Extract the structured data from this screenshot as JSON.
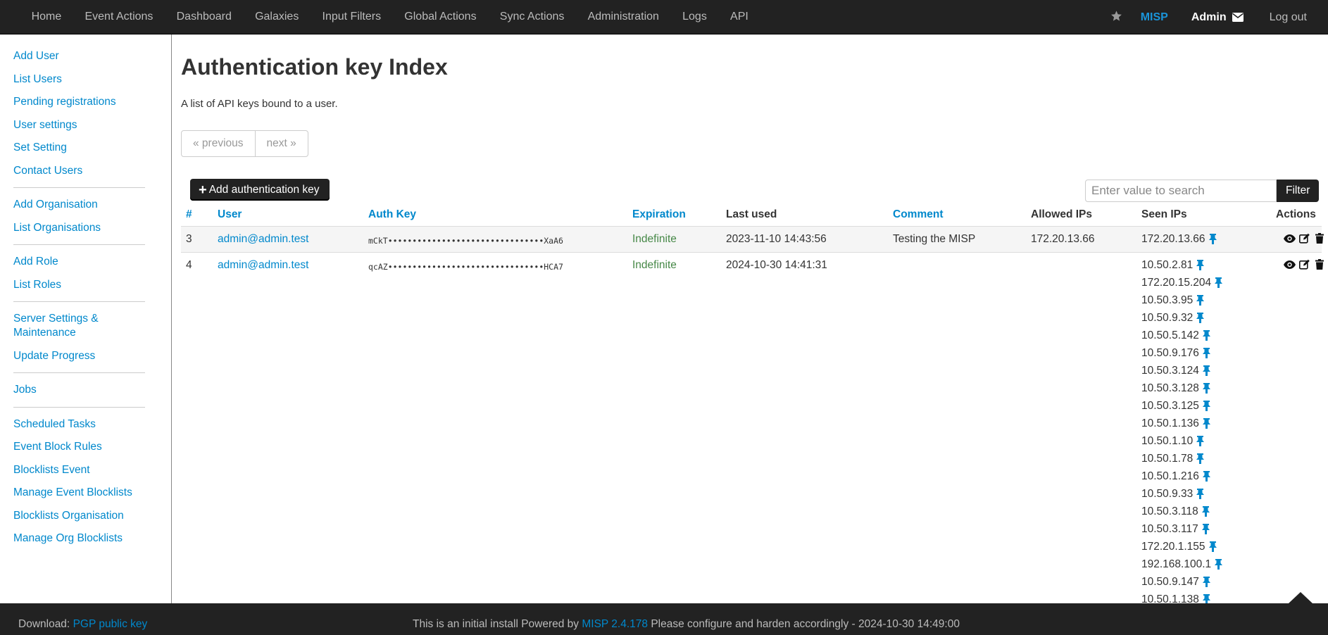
{
  "nav": {
    "items": [
      "Home",
      "Event Actions",
      "Dashboard",
      "Galaxies",
      "Input Filters",
      "Global Actions",
      "Sync Actions",
      "Administration",
      "Logs",
      "API"
    ],
    "brand": "MISP",
    "user": "Admin",
    "logout": "Log out",
    "star_icon": "star-icon",
    "mail_icon": "envelope-icon"
  },
  "sidebar": {
    "groups": [
      [
        "Add User",
        "List Users",
        "Pending registrations",
        "User settings",
        "Set Setting",
        "Contact Users"
      ],
      [
        "Add Organisation",
        "List Organisations"
      ],
      [
        "Add Role",
        "List Roles"
      ],
      [
        "Server Settings & Maintenance",
        "Update Progress"
      ],
      [
        "Jobs"
      ],
      [
        "Scheduled Tasks",
        "Event Block Rules",
        "Blocklists Event",
        "Manage Event Blocklists",
        "Blocklists Organisation",
        "Manage Org Blocklists"
      ]
    ]
  },
  "page": {
    "title": "Authentication key Index",
    "description": "A list of API keys bound to a user.",
    "prev": "« previous",
    "next": "next »",
    "add_button": "Add authentication key",
    "search_placeholder": "Enter value to search",
    "filter_button": "Filter"
  },
  "table": {
    "headers": [
      "#",
      "User",
      "Auth Key",
      "Expiration",
      "Last used",
      "Comment",
      "Allowed IPs",
      "Seen IPs",
      "Actions"
    ],
    "rows": [
      {
        "id": "3",
        "user": "admin@admin.test",
        "key": "mCkT••••••••••••••••••••••••••••••••XaA6",
        "expiration": "Indefinite",
        "last_used": "2023-11-10 14:43:56",
        "comment": "Testing the MISP",
        "allowed_ips": "172.20.13.66",
        "seen_ips": [
          "172.20.13.66"
        ]
      },
      {
        "id": "4",
        "user": "admin@admin.test",
        "key": "qcAZ••••••••••••••••••••••••••••••••HCA7",
        "expiration": "Indefinite",
        "last_used": "2024-10-30 14:41:31",
        "comment": "",
        "allowed_ips": "",
        "seen_ips": [
          "10.50.2.81",
          "172.20.15.204",
          "10.50.3.95",
          "10.50.9.32",
          "10.50.5.142",
          "10.50.9.176",
          "10.50.3.124",
          "10.50.3.128",
          "10.50.3.125",
          "10.50.1.136",
          "10.50.1.10",
          "10.50.1.78",
          "10.50.1.216",
          "10.50.9.33",
          "10.50.3.118",
          "10.50.3.117",
          "172.20.1.155",
          "192.168.100.1",
          "10.50.9.147",
          "10.50.1.138"
        ]
      }
    ]
  },
  "footer": {
    "download_label": "Download:",
    "pgp_link": "PGP public key",
    "text_before": "This is an initial install Powered by",
    "version_link": "MISP 2.4.178",
    "text_after": "Please configure and harden accordingly - 2024-10-30 14:49:00"
  },
  "colors": {
    "link": "#0088cc",
    "navbar": "#222222",
    "expiration": "#468847"
  }
}
